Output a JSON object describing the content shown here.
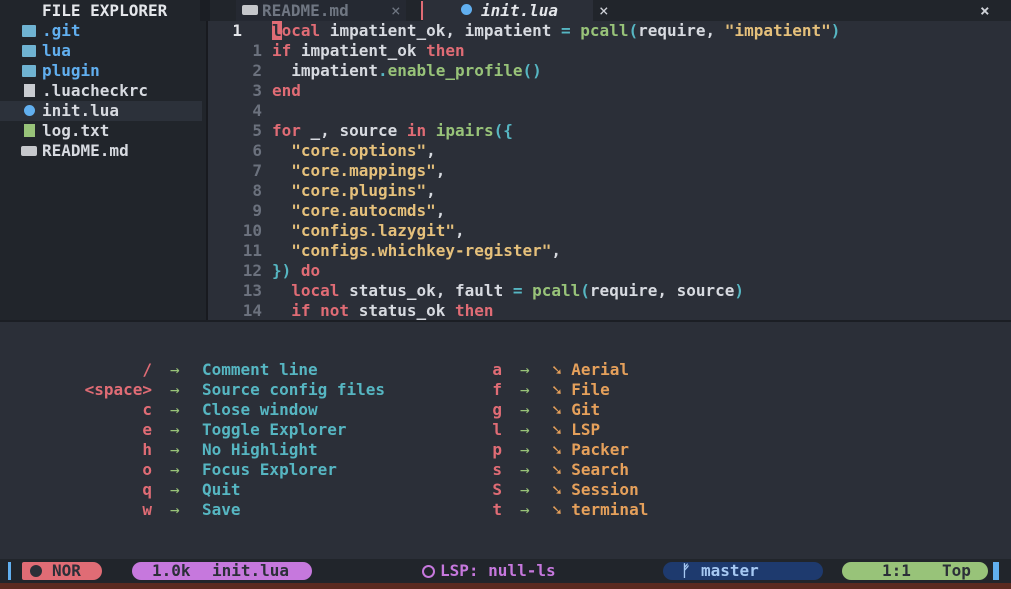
{
  "tabline": {
    "explorer_title": "FILE EXPLORER",
    "tabs": [
      {
        "label": "README.md",
        "close": "×",
        "active": false
      },
      {
        "label": "init.lua",
        "close": "×",
        "active": true
      }
    ],
    "close_all": "×"
  },
  "explorer": {
    "items": [
      {
        "name": ".git",
        "icon": "folder-icon"
      },
      {
        "name": "lua",
        "icon": "folder-icon"
      },
      {
        "name": "plugin",
        "icon": "folder-icon"
      },
      {
        "name": ".luacheckrc",
        "icon": "file-icon"
      },
      {
        "name": "init.lua",
        "icon": "lua-icon",
        "selected": true
      },
      {
        "name": "log.txt",
        "icon": "text-file-icon"
      },
      {
        "name": "README.md",
        "icon": "markdown-icon"
      }
    ]
  },
  "editor": {
    "line_numbers": [
      "1",
      "1",
      "2",
      "3",
      "4",
      "5",
      "6",
      "7",
      "8",
      "9",
      "10",
      "11",
      "12",
      "13",
      "14"
    ]
  },
  "whichkey": {
    "left": [
      {
        "key": "/",
        "arrow": "→",
        "desc": "Comment line"
      },
      {
        "key": "<space>",
        "arrow": "→",
        "desc": "Source config files"
      },
      {
        "key": "c",
        "arrow": "→",
        "desc": "Close window"
      },
      {
        "key": "e",
        "arrow": "→",
        "desc": "Toggle Explorer"
      },
      {
        "key": "h",
        "arrow": "→",
        "desc": "No Highlight"
      },
      {
        "key": "o",
        "arrow": "→",
        "desc": "Focus Explorer"
      },
      {
        "key": "q",
        "arrow": "→",
        "desc": "Quit"
      },
      {
        "key": "w",
        "arrow": "→",
        "desc": "Save"
      }
    ],
    "right": [
      {
        "key": "a",
        "arrow": "→",
        "desc": "➘ Aerial"
      },
      {
        "key": "f",
        "arrow": "→",
        "desc": "➘ File"
      },
      {
        "key": "g",
        "arrow": "→",
        "desc": "➘ Git"
      },
      {
        "key": "l",
        "arrow": "→",
        "desc": "➘ LSP"
      },
      {
        "key": "p",
        "arrow": "→",
        "desc": "➘ Packer"
      },
      {
        "key": "s",
        "arrow": "→",
        "desc": "➘ Search"
      },
      {
        "key": "S",
        "arrow": "→",
        "desc": "➘ Session"
      },
      {
        "key": "t",
        "arrow": "→",
        "desc": "➘ terminal"
      }
    ]
  },
  "statusline": {
    "mode": "NOR",
    "file_size": "1.0k",
    "file_name": "init.lua",
    "lsp": "LSP: null-ls",
    "git_icon": "ᚠ",
    "branch": "master",
    "position": "1:1",
    "percent": "Top"
  },
  "colors": {
    "background": "#2b2f38",
    "keyword": "#e06c75",
    "string": "#e5c07b",
    "function": "#98c379",
    "operator": "#56b6c2",
    "accent_blue": "#61afef",
    "accent_purple": "#c678dd"
  }
}
